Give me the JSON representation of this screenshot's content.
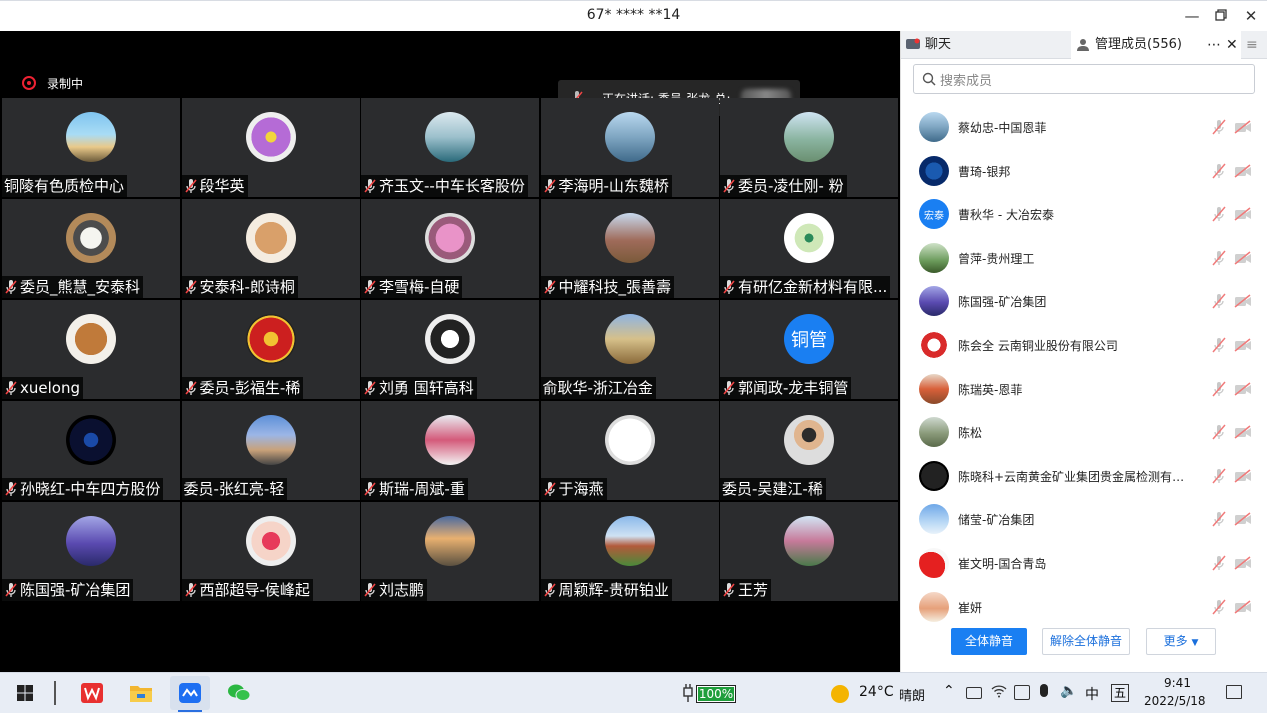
{
  "window": {
    "title": "67* **** **14"
  },
  "recording": {
    "label": "录制中"
  },
  "speaking": {
    "label": "正在讲话: 委员-张龙-总;"
  },
  "tiles": [
    {
      "name": "铜陵有色质检中心",
      "mic": false,
      "av": "beach"
    },
    {
      "name": "段华英",
      "mic": true,
      "av": "flower"
    },
    {
      "name": "齐玉文--中车长客股份",
      "mic": true,
      "av": "sea"
    },
    {
      "name": "李海明-山东魏桥",
      "mic": true,
      "av": "lake"
    },
    {
      "name": "委员-凌仕刚- 粉",
      "mic": true,
      "av": "river"
    },
    {
      "name": "委员_熊慧_安泰科",
      "mic": true,
      "av": "lemur"
    },
    {
      "name": "安泰科-郎诗桐",
      "mic": true,
      "av": "cat"
    },
    {
      "name": "李雪梅-自硬",
      "mic": true,
      "av": "pink"
    },
    {
      "name": "中耀科技_張善壽",
      "mic": true,
      "av": "yard"
    },
    {
      "name": "有研亿金新材料有限...",
      "mic": true,
      "av": "eye"
    },
    {
      "name": "xuelong",
      "mic": true,
      "av": "bear"
    },
    {
      "name": "委员-彭福生-稀",
      "mic": true,
      "av": "seal"
    },
    {
      "name": "刘勇 国轩高科",
      "mic": true,
      "av": "penguin"
    },
    {
      "name": "俞耿华-浙江冶金",
      "mic": false,
      "av": "castle"
    },
    {
      "name": "郭闻政-龙丰铜管",
      "mic": true,
      "av": "text",
      "avtext": "铜管"
    },
    {
      "name": "孙晓红-中车四方股份",
      "mic": true,
      "av": "space"
    },
    {
      "name": "委员-张红亮-轻",
      "mic": false,
      "av": "road"
    },
    {
      "name": "斯瑞-周斌-重",
      "mic": true,
      "av": "girl"
    },
    {
      "name": "于海燕",
      "mic": true,
      "av": "sketch"
    },
    {
      "name": "委员-吴建江-稀",
      "mic": false,
      "av": "man"
    },
    {
      "name": "陈国强-矿冶集团",
      "mic": true,
      "av": "purple"
    },
    {
      "name": "西部超导-侯峰起",
      "mic": true,
      "av": "baby"
    },
    {
      "name": "刘志鹏",
      "mic": true,
      "av": "sunset"
    },
    {
      "name": "周颖辉-贵研铂业",
      "mic": true,
      "av": "field"
    },
    {
      "name": "王芳",
      "mic": true,
      "av": "garden"
    }
  ],
  "panel": {
    "tab_chat": "聊天",
    "tab_members": "管理成员(556)",
    "search_placeholder": "搜索成员",
    "members": [
      {
        "name": "蔡幼忠-中国恩菲",
        "av": "lake"
      },
      {
        "name": "曹琦-银邦",
        "av": "blue"
      },
      {
        "name": "曹秋华 - 大冶宏泰",
        "av": "text",
        "avtext": "宏泰"
      },
      {
        "name": "曾萍-贵州理工",
        "av": "green"
      },
      {
        "name": "陈国强-矿冶集团",
        "av": "purple"
      },
      {
        "name": "陈会全  云南铜业股份有限公司",
        "av": "redlogo"
      },
      {
        "name": "陈瑞英-恩菲",
        "av": "woman"
      },
      {
        "name": "陈松",
        "av": "building"
      },
      {
        "name": "陈晓科+云南黄金矿业集团贵金属检测有限...",
        "av": "black"
      },
      {
        "name": "储莹-矿冶集团",
        "av": "sky"
      },
      {
        "name": "崔文明-国合青岛",
        "av": "red"
      },
      {
        "name": "崔妍",
        "av": "kids"
      }
    ],
    "btn_mute_all": "全体静音",
    "btn_unmute_all": "解除全体静音",
    "btn_more": "更多"
  },
  "taskbar": {
    "battery": "100%",
    "temperature": "24°C",
    "weather": "晴朗",
    "ime": "中",
    "ime2": "五",
    "time": "9:41",
    "date": "2022/5/18"
  }
}
